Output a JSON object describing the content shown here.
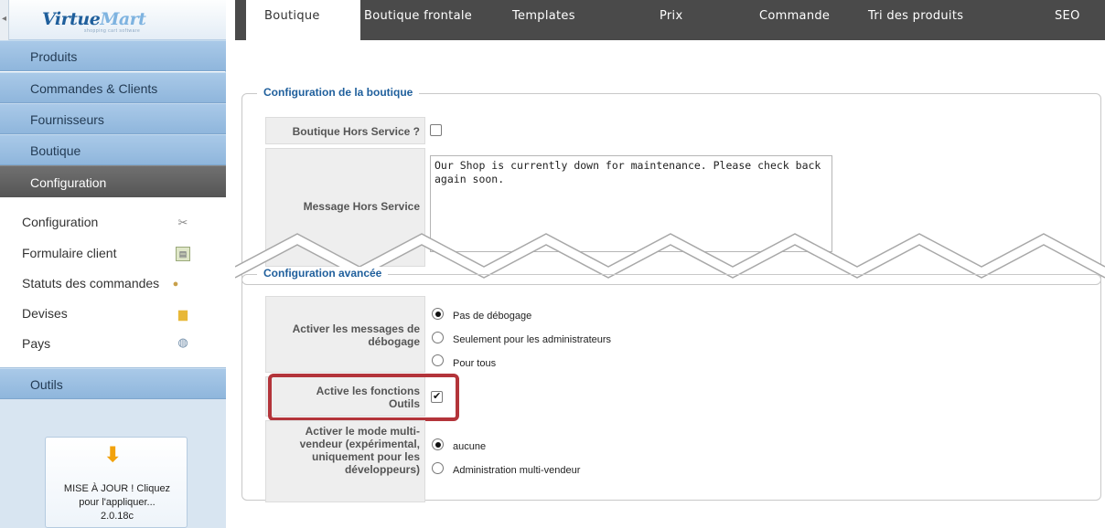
{
  "sidebar": {
    "logo": {
      "text_main": "Virtue",
      "text_accent": "Mart",
      "subtitle": "shopping cart software"
    },
    "nav": [
      {
        "label": "Produits"
      },
      {
        "label": "Commandes & Clients"
      },
      {
        "label": "Fournisseurs"
      },
      {
        "label": "Boutique"
      },
      {
        "label": "Configuration",
        "active": true
      }
    ],
    "submenu": [
      {
        "label": "Configuration",
        "icon": "tools-icon"
      },
      {
        "label": "Formulaire client",
        "icon": "form-icon"
      },
      {
        "label": "Statuts des commandes",
        "icon": "status-icon"
      },
      {
        "label": "Devises",
        "icon": "coins-icon"
      },
      {
        "label": "Pays",
        "icon": "globe-icon"
      }
    ],
    "tools": {
      "label": "Outils"
    },
    "update": {
      "line1": "MISE À JOUR ! Cliquez",
      "line2": "pour l'appliquer...",
      "version": "2.0.18c"
    }
  },
  "tabs": [
    {
      "label": "Boutique",
      "active": true
    },
    {
      "label": "Boutique frontale"
    },
    {
      "label": "Templates"
    },
    {
      "label": "Prix"
    },
    {
      "label": "Commande"
    },
    {
      "label": "Tri des produits"
    },
    {
      "label": "SEO"
    }
  ],
  "shop_config": {
    "legend": "Configuration de la boutique",
    "offline_label": "Boutique Hors Service ?",
    "offline_checked": false,
    "message_label": "Message Hors Service",
    "message_value": "Our Shop is currently down for maintenance. Please check back again soon."
  },
  "advanced_config": {
    "legend": "Configuration avancée",
    "debug_label_1": "Activer les messages de",
    "debug_label_2": "débogage",
    "debug_options": [
      {
        "label": "Pas de débogage",
        "selected": true
      },
      {
        "label": "Seulement pour les administrateurs",
        "selected": false
      },
      {
        "label": "Pour tous",
        "selected": false
      }
    ],
    "tools_label_1": "Active les fonctions",
    "tools_label_2": "Outils",
    "tools_checked": true,
    "multivendor_label_1": "Activer le mode multi-",
    "multivendor_label_2": "vendeur (expérimental,",
    "multivendor_label_3": "uniquement pour les",
    "multivendor_label_4": "développeurs)",
    "multivendor_options": [
      {
        "label": "aucune",
        "selected": true
      },
      {
        "label": "Administration multi-vendeur",
        "selected": false
      }
    ]
  },
  "colors": {
    "accent": "#1f5f9c",
    "highlight": "#b3343a",
    "tab_bar": "#4a4a4a",
    "nav_active": "#555555"
  }
}
